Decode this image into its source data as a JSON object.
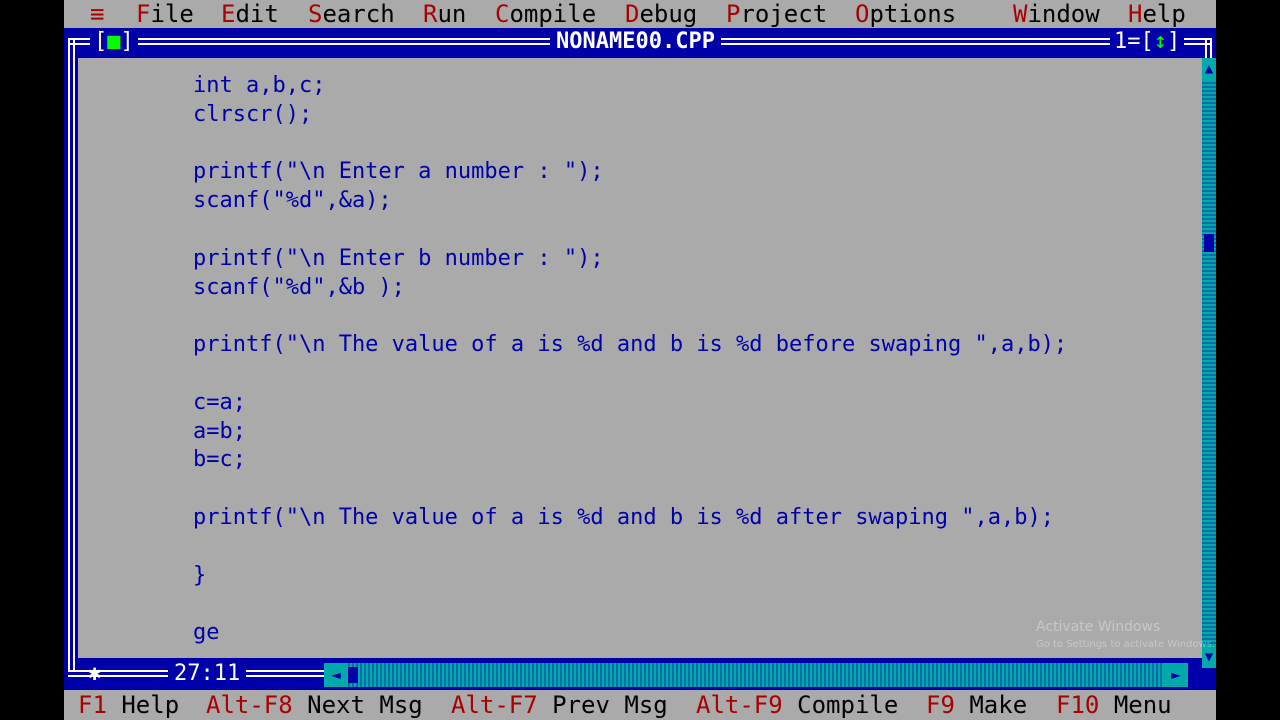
{
  "menubar": {
    "system_glyph": "≡",
    "items": [
      {
        "hot": "F",
        "rest": "ile"
      },
      {
        "hot": "E",
        "rest": "dit"
      },
      {
        "hot": "S",
        "rest": "earch"
      },
      {
        "hot": "R",
        "rest": "un"
      },
      {
        "hot": "C",
        "rest": "ompile"
      },
      {
        "hot": "D",
        "rest": "ebug"
      },
      {
        "hot": "P",
        "rest": "roject"
      },
      {
        "hot": "O",
        "rest": "ptions"
      },
      {
        "hot": "W",
        "rest": "indow"
      },
      {
        "hot": "H",
        "rest": "elp"
      }
    ]
  },
  "window": {
    "title": "NONAME00.CPP",
    "close_left": "[",
    "close_glyph": "■",
    "close_right": "]",
    "number_label": "1=",
    "zoom_left": "[",
    "zoom_glyph": "↕",
    "zoom_right": "]",
    "cursor_position": "27:11",
    "modified_glyph": "✱"
  },
  "code_lines": [
    "int a,b,c;",
    "clrscr();",
    "",
    "printf(\"\\n Enter a number : \");",
    "scanf(\"%d\",&a);",
    "",
    "printf(\"\\n Enter b number : \");",
    "scanf(\"%d\",&b );",
    "",
    "printf(\"\\n The value of a is %d and b is %d before swaping \",a,b);",
    "",
    "c=a;",
    "a=b;",
    "b=c;",
    "",
    "printf(\"\\n The value of a is %d and b is %d after swaping \",a,b);",
    "",
    "}",
    "",
    "ge"
  ],
  "scroll": {
    "up": "▲",
    "down": "▼",
    "left": "◄",
    "right": "►"
  },
  "fkeys": [
    {
      "key": "F1",
      "label": "Help"
    },
    {
      "key": "Alt-F8",
      "label": "Next Msg"
    },
    {
      "key": "Alt-F7",
      "label": "Prev Msg"
    },
    {
      "key": "Alt-F9",
      "label": "Compile"
    },
    {
      "key": "F9",
      "label": "Make"
    },
    {
      "key": "F10",
      "label": "Menu"
    }
  ],
  "watermark": {
    "line1": "Activate Windows",
    "line2": "Go to Settings to activate Windows."
  }
}
